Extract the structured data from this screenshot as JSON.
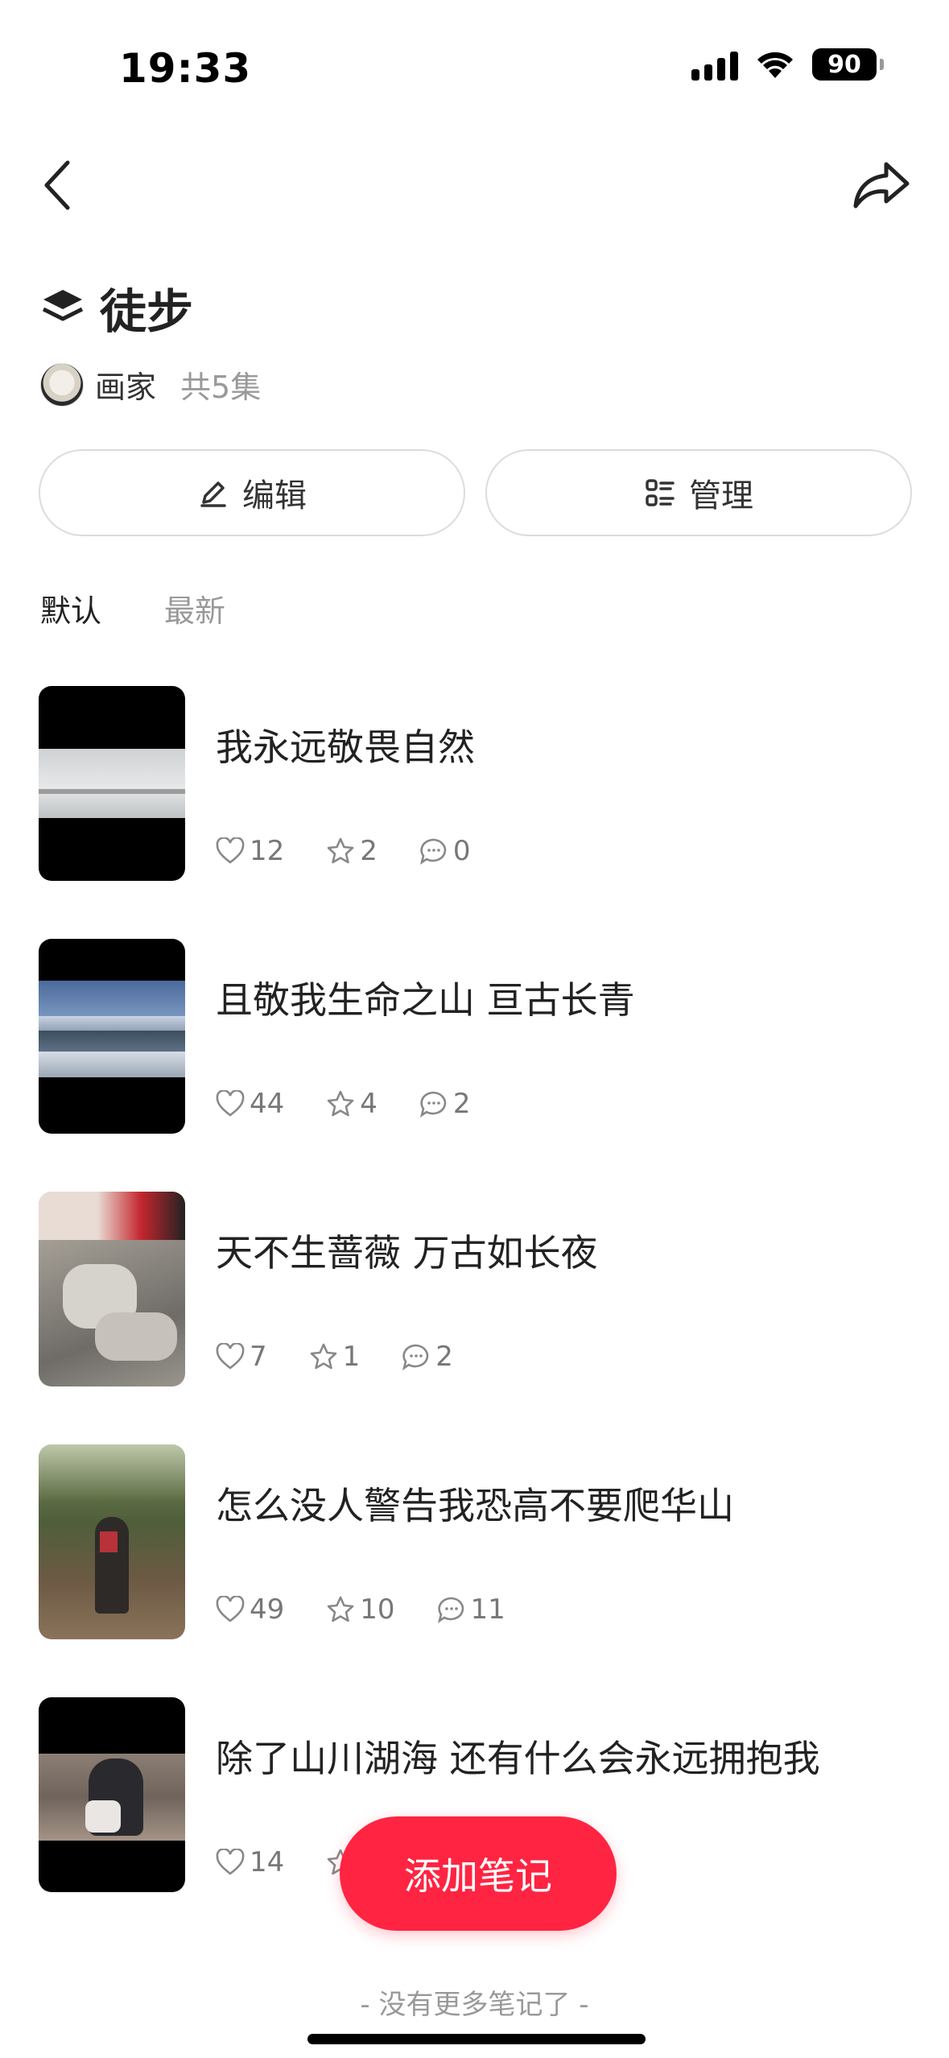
{
  "status_bar": {
    "time": "19:33",
    "battery": "90"
  },
  "header": {
    "title": "徒步",
    "author": "画家",
    "episode_count": "共5集"
  },
  "actions": {
    "edit_label": "编辑",
    "manage_label": "管理"
  },
  "sort_tabs": [
    {
      "label": "默认",
      "active": true
    },
    {
      "label": "最新",
      "active": false
    }
  ],
  "notes": [
    {
      "title": "我永远敬畏自然",
      "likes": "12",
      "collects": "2",
      "comments": "0"
    },
    {
      "title": "且敬我生命之山 亘古长青",
      "likes": "44",
      "collects": "4",
      "comments": "2"
    },
    {
      "title": "天不生蔷薇 万古如长夜",
      "likes": "7",
      "collects": "1",
      "comments": "2"
    },
    {
      "title": "怎么没人警告我恐高不要爬华山",
      "likes": "49",
      "collects": "10",
      "comments": "11"
    },
    {
      "title": "除了山川湖海 还有什么会永远拥抱我",
      "likes": "14",
      "collects": "",
      "comments": ""
    }
  ],
  "fab": {
    "label": "添加笔记"
  },
  "footer": {
    "text": "- 没有更多笔记了 -"
  },
  "colors": {
    "accent": "#ff2442",
    "text": "#222222",
    "muted": "#999999"
  }
}
